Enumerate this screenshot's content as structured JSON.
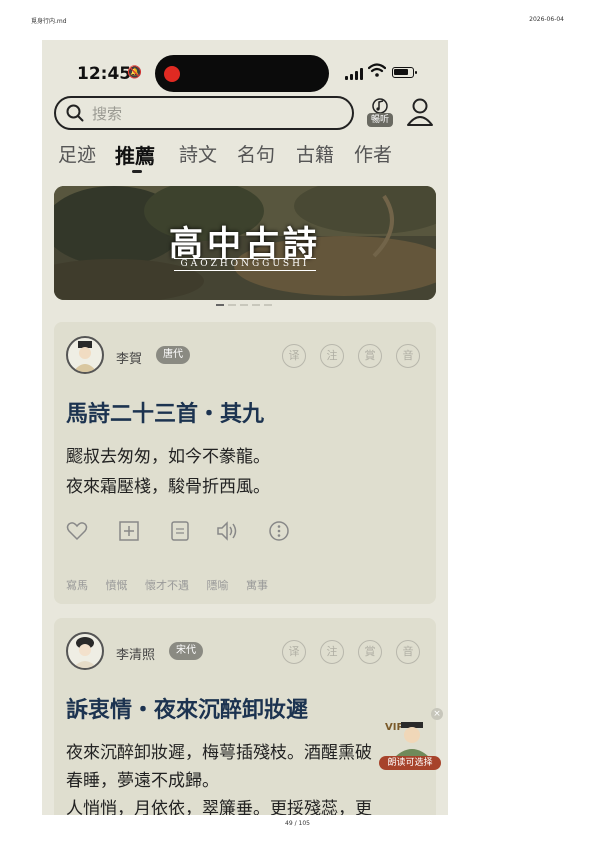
{
  "doc": {
    "file_name": "覓身行内.md",
    "date": "2026-06-04",
    "page": "49 / 105"
  },
  "status": {
    "time": "12:45"
  },
  "search": {
    "placeholder": "搜索"
  },
  "header": {
    "listen_label": "暢听"
  },
  "tabs": [
    "足迹",
    "推薦",
    "詩文",
    "名句",
    "古籍",
    "作者"
  ],
  "active_tab": "推薦",
  "banner": {
    "title": "高中古詩",
    "subtitle": "GAOZHONGGUSHI"
  },
  "seal_labels": [
    "译",
    "注",
    "賞",
    "音"
  ],
  "cards": [
    {
      "poet": "李賀",
      "era": "唐代",
      "title": "馬詩二十三首・其九",
      "lines": [
        "飂叔去匆匆，如今不豢龍。",
        "夜來霜壓棧，駿骨折西風。"
      ],
      "tags": [
        "寫馬",
        "憤慨",
        "懷才不遇",
        "隱喻",
        "寓事"
      ]
    },
    {
      "poet": "李清照",
      "era": "宋代",
      "title": "訴衷情・夜來沉醉卸妝遲",
      "lines": [
        "夜來沉醉卸妝遲，梅萼插殘枝。酒醒熏破",
        "春睡，夢遠不成歸。",
        "人悄悄，月依依，翠簾垂。更挼殘蕊，更"
      ]
    }
  ],
  "floating": {
    "badge": "VIP",
    "label": "朗读可选择"
  },
  "colors": {
    "background": "#e8e7dc",
    "card": "#dfdecf",
    "title": "#1c3350",
    "record": "#e02a22"
  }
}
